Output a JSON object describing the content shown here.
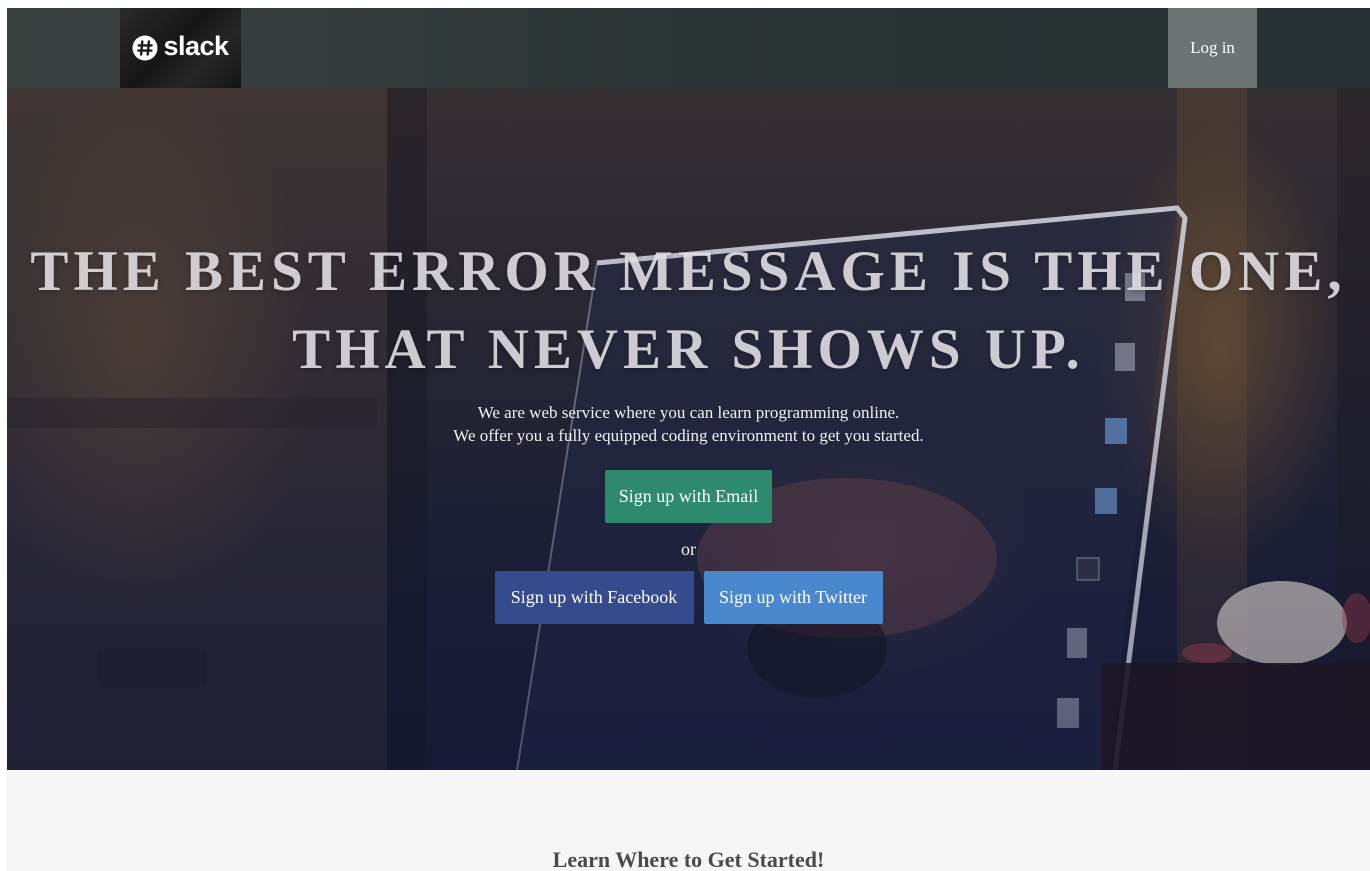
{
  "nav": {
    "brand_text": "slack",
    "brand_icon": "slack-hash-icon",
    "login_label": "Log in"
  },
  "hero": {
    "headline_line1": "THE BEST ERROR MESSAGE IS THE ONE,",
    "headline_line2": "THAT NEVER SHOWS UP.",
    "subtext_line1": "We are web service where you can learn programming online.",
    "subtext_line2": "We offer you a fully equipped coding environment to get you started.",
    "email_button": "Sign up with Email",
    "or_text": "or",
    "facebook_button": "Sign up with Facebook",
    "twitter_button": "Sign up with Twitter"
  },
  "lower": {
    "section_title": "Learn Where to Get Started!"
  },
  "colors": {
    "nav_bg": "#2c3535",
    "login_bg": "#6c7373",
    "email_button": "#2e8a6c",
    "facebook_button": "#344c8e",
    "twitter_button": "#4988cf",
    "page_bg": "#f6f6f6"
  }
}
